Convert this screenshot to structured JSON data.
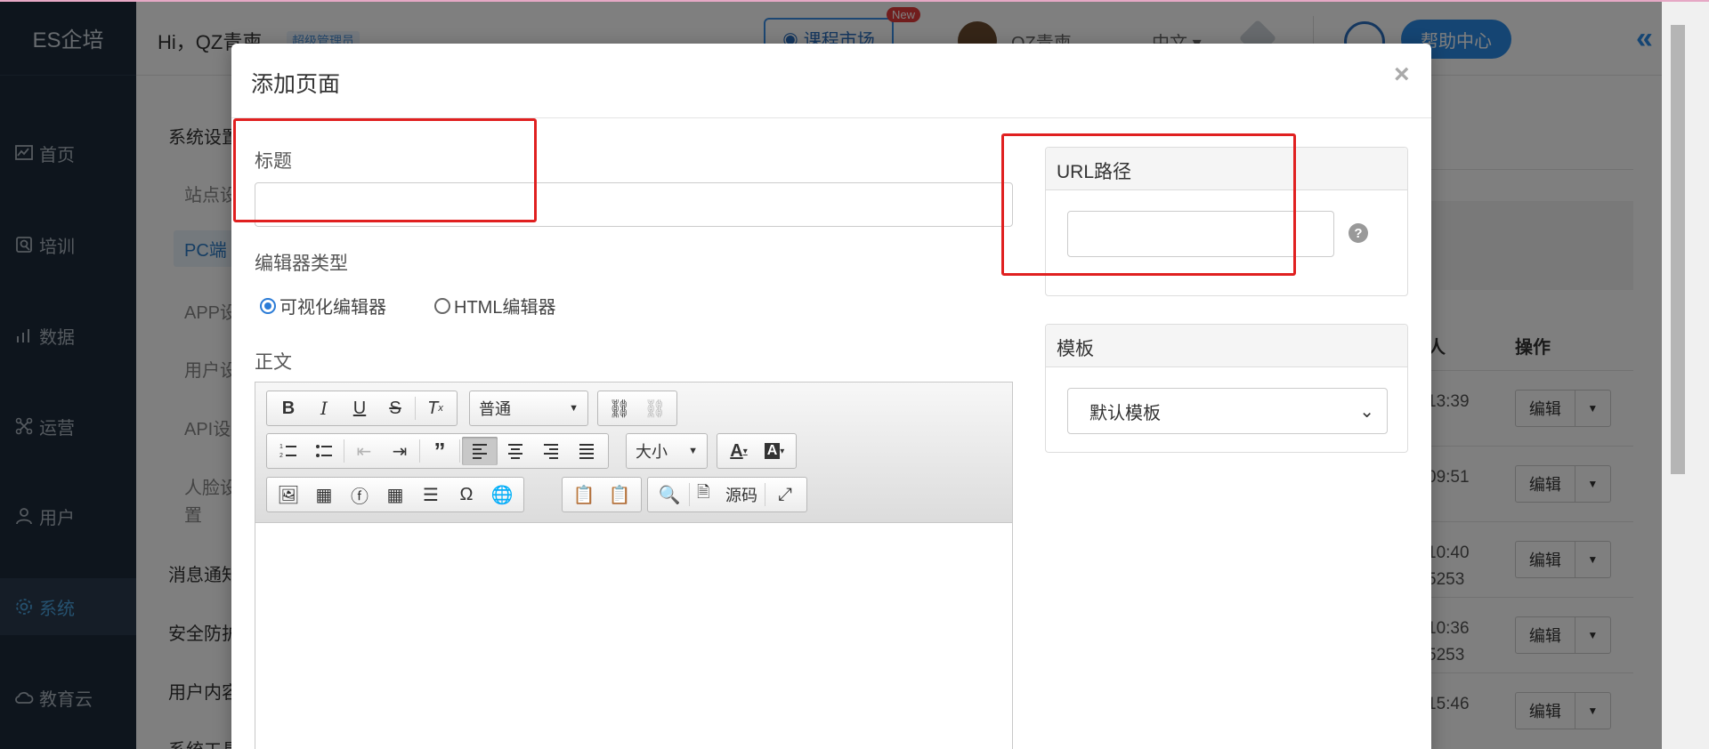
{
  "app": {
    "brand": "ES企培",
    "greeting": "Hi，QZ青柬",
    "role": "超级管理员",
    "market_button": "课程市场",
    "new_badge": "New",
    "username": "QZ青柬",
    "language": "中文",
    "help_center": "帮助中心"
  },
  "sidebar": {
    "items": [
      {
        "label": "首页",
        "icon": "chart-icon"
      },
      {
        "label": "培训",
        "icon": "training-icon"
      },
      {
        "label": "数据",
        "icon": "data-icon"
      },
      {
        "label": "运营",
        "icon": "operations-icon"
      },
      {
        "label": "用户",
        "icon": "user-icon"
      },
      {
        "label": "系统",
        "icon": "gear-icon",
        "active": true
      },
      {
        "label": "教育云",
        "icon": "cloud-icon"
      }
    ]
  },
  "subnav": {
    "system_settings": "系统设置",
    "site": "站点设",
    "pc": "PC端",
    "app": "APP设",
    "user": "用户设",
    "api": "API设",
    "face_1": "人脸设",
    "face_2": "置",
    "message": "消息通知",
    "security": "安全防护",
    "user_content": "用户内容",
    "system_tools": "系统工具"
  },
  "table": {
    "col_partial": "人",
    "col_action": "操作",
    "rows": [
      {
        "time": "13:39",
        "extra": "",
        "edit": "编辑"
      },
      {
        "time": "09:51",
        "extra": "",
        "edit": "编辑"
      },
      {
        "time": "10:40",
        "extra": "5253",
        "edit": "编辑"
      },
      {
        "time": "10:36",
        "extra": "5253",
        "edit": "编辑"
      },
      {
        "time": "15:46",
        "extra": "",
        "edit": "编辑"
      }
    ]
  },
  "modal": {
    "title": "添加页面",
    "close": "×",
    "title_label": "标题",
    "title_value": "",
    "editor_type_label": "编辑器类型",
    "editor_types": [
      {
        "label": "可视化编辑器",
        "checked": true
      },
      {
        "label": "HTML编辑器",
        "checked": false
      }
    ],
    "body_label": "正文",
    "toolbar": {
      "format": "普通",
      "size": "大小",
      "source": "源码"
    },
    "url_card_title": "URL路径",
    "url_value": "",
    "help_icon": "?",
    "template_card_title": "模板",
    "template_selected": "默认模板"
  },
  "colors": {
    "sidebar_bg": "#1c2a3a",
    "accent": "#2b8be6",
    "highlight_box": "#e02020"
  }
}
